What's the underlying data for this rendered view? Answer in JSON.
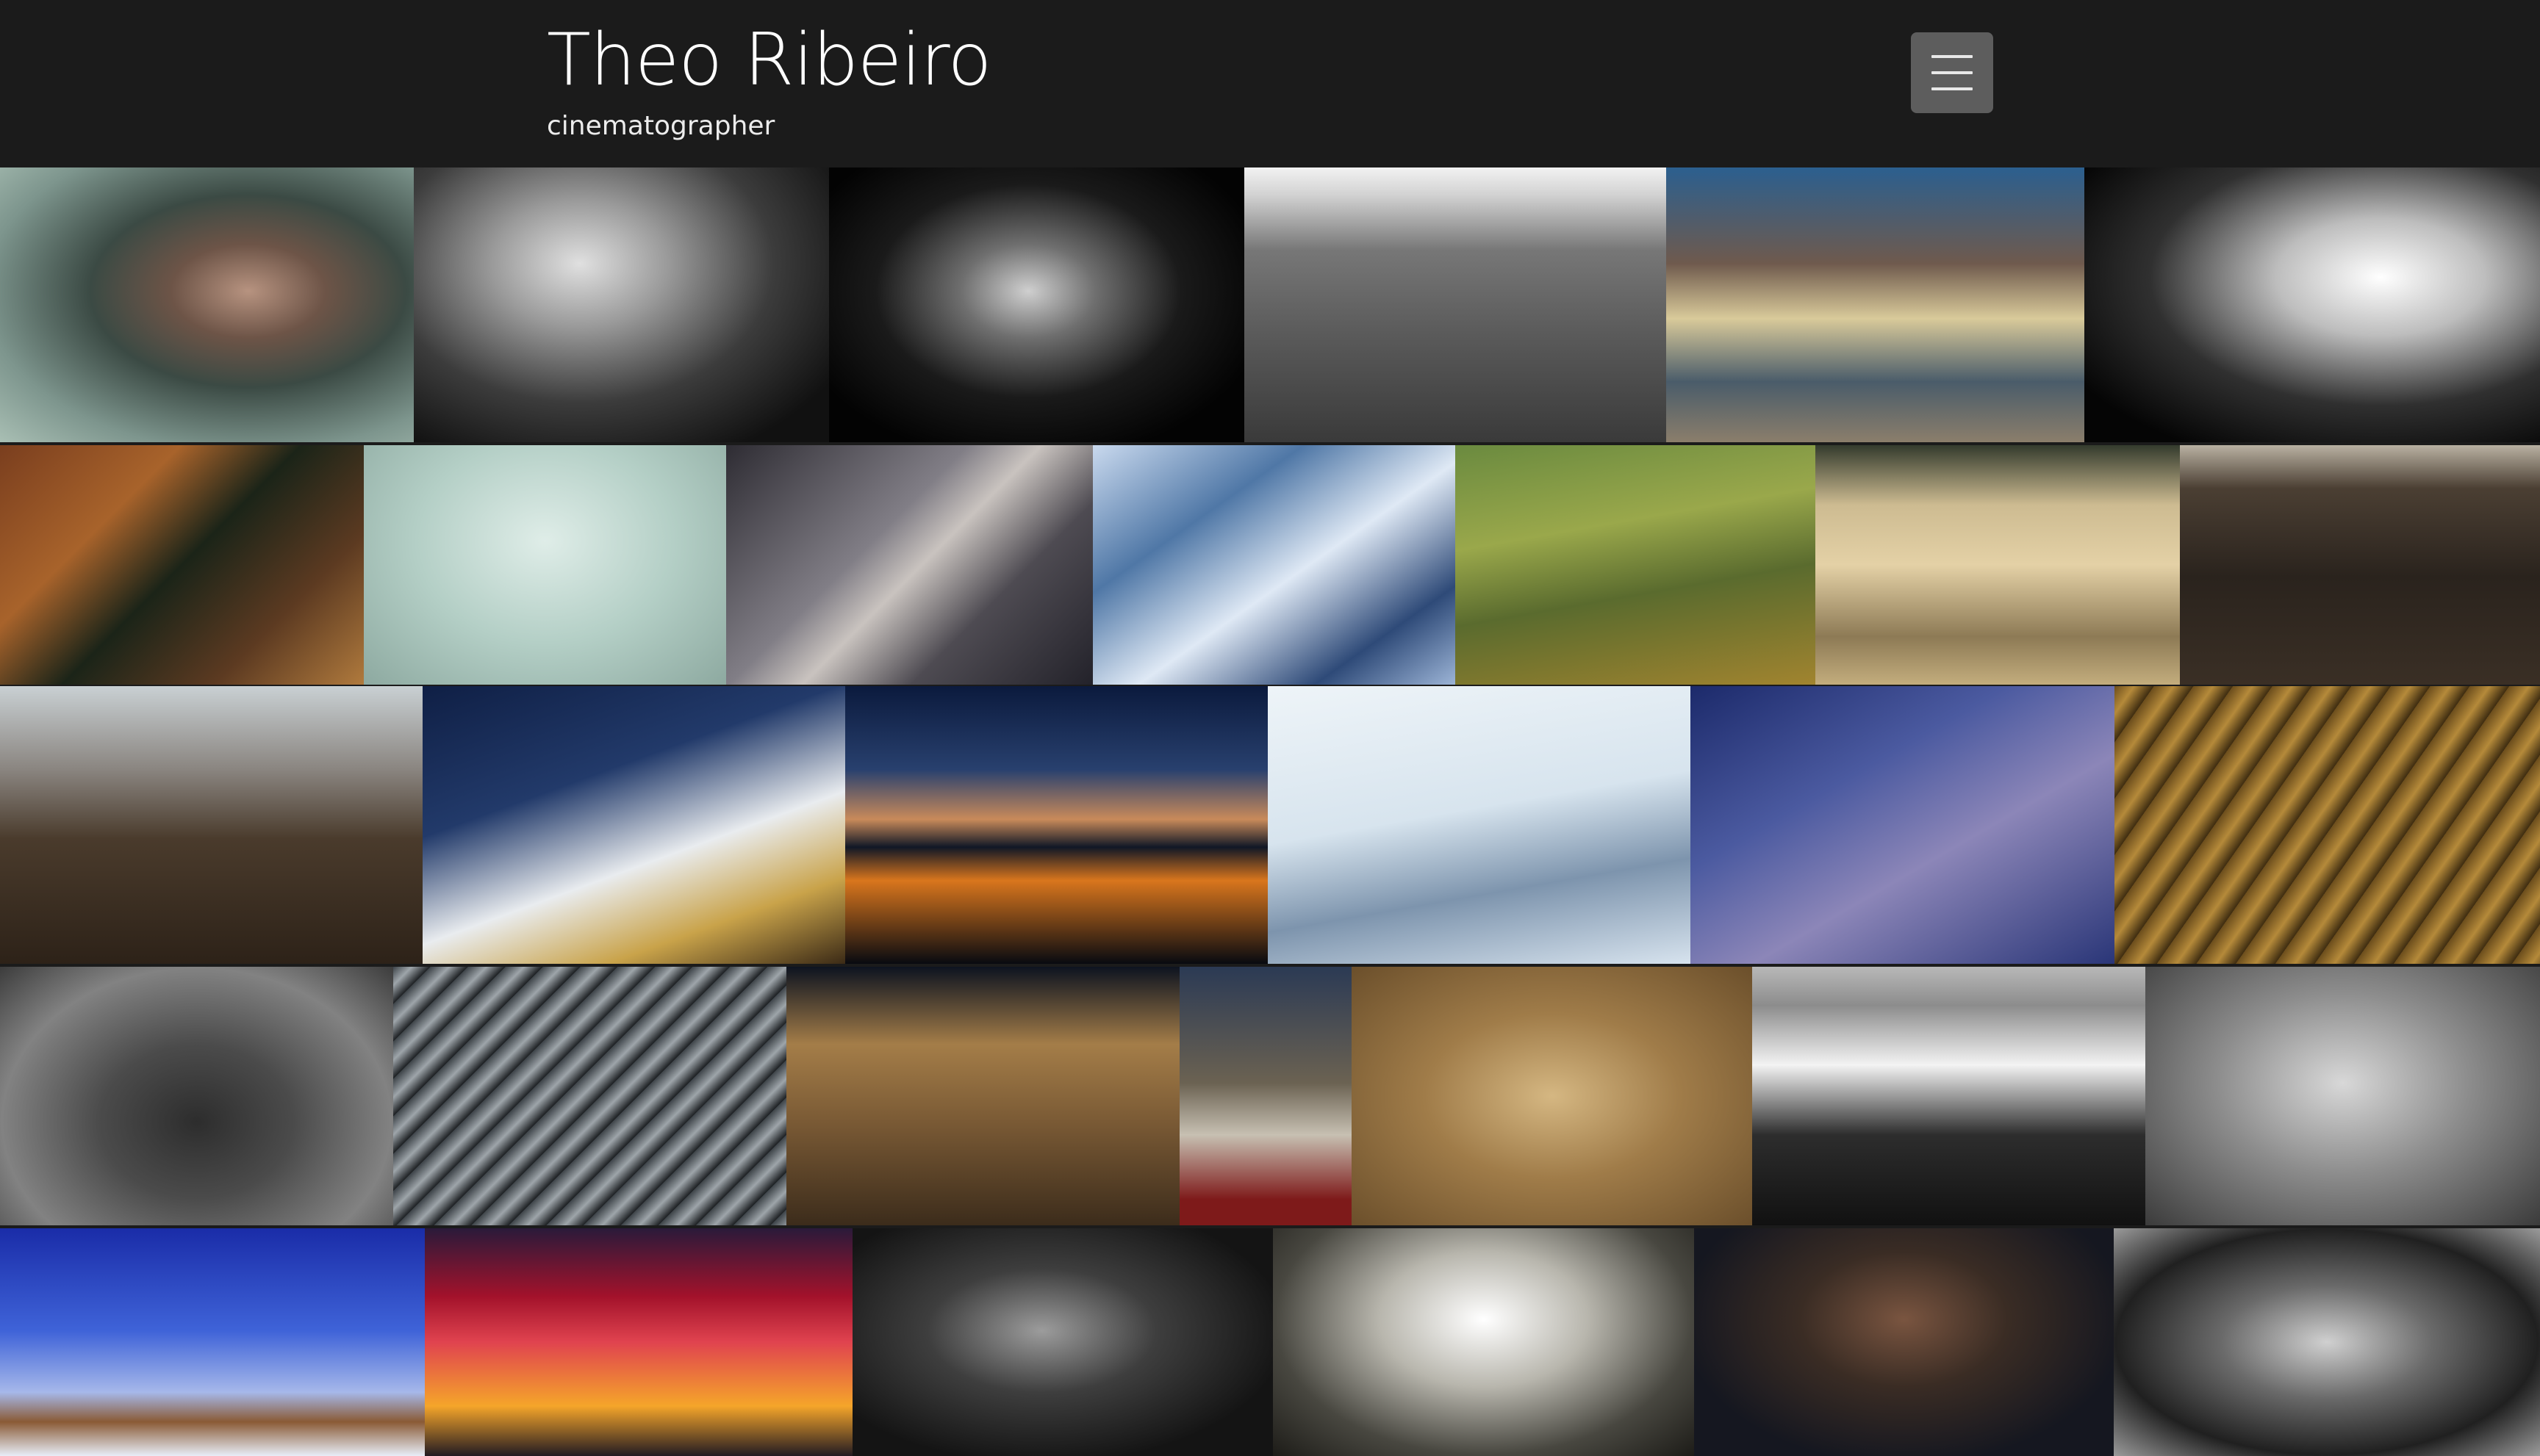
{
  "header": {
    "name": "Theo Ribeiro",
    "tagline": "cinematographer",
    "menu_icon": "hamburger-icon"
  },
  "gallery": {
    "rows": [
      {
        "tiles": [
          {
            "name": "photo-girl-portrait",
            "bg": "radial-gradient(ellipse at 60% 45%, #b79380 0%, #6d5447 22%, #3b4a44 45%, #7d958d 75%, #a9bfb4 100%)"
          },
          {
            "name": "photo-hands-over-eyes",
            "bg": "radial-gradient(ellipse at 40% 35%, #e0e0e0 0%, #9a9a9a 25%, #3c3c3c 55%, #111 85%)"
          },
          {
            "name": "photo-man-face-dark",
            "bg": "radial-gradient(ellipse at 48% 45%, #cfcfcf 0%, #6f6f6f 22%, #1a1a1a 50%, #030303 80%)"
          },
          {
            "name": "photo-building-bw",
            "bg": "linear-gradient(180deg, #f2f2f2 0%, #d2d2d2 10%, #777 30%, #5b5b5b 60%, #3a3a3a 100%)"
          },
          {
            "name": "photo-rickshaw-street",
            "bg": "linear-gradient(180deg, #2b5f8f 0%, #6f5a4d 35%, #d9ca9a 55%, #4a5c6a 78%, #8b7e6b 100%)"
          },
          {
            "name": "photo-car-drifting-smoke",
            "bg": "radial-gradient(ellipse at 65% 40%, #ffffff 0%, #bdbdbd 25%, #303030 55%, #050505 85%)"
          }
        ],
        "widths": [
          563,
          565,
          565,
          574,
          569,
          620
        ]
      },
      {
        "tiles": [
          {
            "name": "photo-climber-cliff",
            "bg": "linear-gradient(135deg, #7a3e1e 0%, #a8632b 30%, #1b2418 50%, #5c3a21 75%, #b07a3d 100%)"
          },
          {
            "name": "photo-mountaineers-fog",
            "bg": "radial-gradient(ellipse at 50% 40%, #dfede8 0%, #b4cfc6 50%, #8da9a0 100%)"
          },
          {
            "name": "photo-ice-axe-rock",
            "bg": "linear-gradient(135deg, #2e2c33 0%, #817e86 40%, #c9c3bf 52%, #4e4b52 70%, #23222a 100%)"
          },
          {
            "name": "photo-glacier-aerial",
            "bg": "linear-gradient(145deg, #c9d9ee 0%, #4f77a6 30%, #dfe9f5 55%, #2e4a78 80%, #9cb4d6 100%)"
          },
          {
            "name": "photo-green-field-road",
            "bg": "linear-gradient(170deg, #6a8a3f 0%, #9aa84b 35%, #5a6b2e 60%, #a1842f 100%)"
          },
          {
            "name": "photo-sand-dunes",
            "bg": "linear-gradient(180deg, #343b2d 0%, #cdbb91 25%, #e4d1a6 50%, #8d7a55 80%, #c3ad7d 100%)"
          },
          {
            "name": "photo-dark-hills-runner",
            "bg": "linear-gradient(180deg, #b9b1a2 0%, #4b3f33 18%, #2a231d 55%, #3a2f25 100%)"
          }
        ],
        "widths": [
          495,
          493,
          499,
          493,
          490,
          496,
          490
        ]
      },
      {
        "tiles": [
          {
            "name": "photo-cyclists-dust",
            "bg": "linear-gradient(180deg, #c9d0d3 0%, #8a8580 30%, #4a3b2c 55%, #2d2218 100%)"
          },
          {
            "name": "photo-mountaineer-snow-night",
            "bg": "linear-gradient(160deg, #0f1f45 0%, #223a6a 35%, #e9ecef 60%, #c9a34a 80%, #3b2a16 100%)"
          },
          {
            "name": "photo-tents-lake-dusk",
            "bg": "linear-gradient(180deg, #0b1a3d 0%, #28406e 30%, #c98a5a 48%, #101726 58%, #d9761d 70%, #080a10 100%)"
          },
          {
            "name": "photo-snowfield-climbers",
            "bg": "linear-gradient(170deg, #eef4f8 0%, #d7e4ee 45%, #7d94ad 70%, #d7e3ee 100%)"
          },
          {
            "name": "photo-terraced-valley",
            "bg": "linear-gradient(150deg, #1c2a6b 0%, #4b5aa0 35%, #8c86b8 60%, #2a3678 100%)"
          },
          {
            "name": "photo-crop-rows-golden",
            "bg": "repeating-linear-gradient(125deg, #6b4d1c 0px, #b58a3a 22px, #3e2c10 44px)"
          }
        ],
        "widths": [
          575,
          575,
          575,
          575,
          577,
          579
        ]
      },
      {
        "tiles": [
          {
            "name": "photo-forest-aerial-bw",
            "bg": "radial-gradient(ellipse at 50% 60%, #2d2d2d 0%, #4b4b4b 35%, #828282 70%, #3c3c3c 100%)"
          },
          {
            "name": "photo-batteries-rows",
            "bg": "repeating-linear-gradient(135deg, #3d4348 0px, #9ea5aa 18px, #1c1f22 36px)"
          },
          {
            "name": "photo-ruined-house-night",
            "bg": "linear-gradient(180deg, #0d1320 0%, #a47d48 30%, #7a5a35 60%, #3c2c1b 100%)"
          },
          {
            "name": "photo-man-sheep",
            "bg": "linear-gradient(180deg, #2b3a54 0%, #6b6252 45%, #c7c0b2 65%, #7e1a1a 90%)"
          },
          {
            "name": "photo-people-mud-helping",
            "bg": "radial-gradient(ellipse at 50% 50%, #d5b782 0%, #a07c49 45%, #6b4f2b 100%)"
          },
          {
            "name": "photo-boy-jumping-water",
            "bg": "linear-gradient(180deg, #b8b8b8 0%, #8c8c8c 15%, #f3f3f3 38%, #2d2d2d 65%, #111 100%)"
          },
          {
            "name": "photo-two-men-seated-bw",
            "bg": "radial-gradient(ellipse at 50% 45%, #d8d8d8 0%, #8d8d8d 45%, #3b3b3b 100%)"
          }
        ],
        "widths": [
          535,
          535,
          535,
          234,
          545,
          535,
          537
        ]
      },
      {
        "tiles": [
          {
            "name": "photo-cactus-salt-flat",
            "bg": "linear-gradient(180deg, #1a2ca8 0%, #3f63d8 45%, #a6b8ea 72%, #8a5a35 85%, #e8eef8 100%)"
          },
          {
            "name": "photo-sunset-city",
            "bg": "linear-gradient(180deg, #2a1a3a 0%, #a3122b 30%, #e0434f 50%, #f5a52a 78%, #221b22 100%)"
          },
          {
            "name": "photo-miner-helmet-bw",
            "bg": "radial-gradient(ellipse at 45% 45%, #9c9c9c 0%, #3e3e3e 35%, #141414 75%)"
          },
          {
            "name": "photo-boy-portrait-field",
            "bg": "radial-gradient(ellipse at 50% 40%, #ffffff 0%, #b8b6ad 35%, #484740 70%, #1d1c18 100%)"
          },
          {
            "name": "photo-woman-food",
            "bg": "radial-gradient(ellipse at 50% 40%, #7a5540 0%, #3a2c24 35%, #151720 75%)"
          },
          {
            "name": "photo-indigenous-man-bw",
            "bg": "radial-gradient(ellipse at 50% 50%, #d0d0d0 0%, #6a6a6a 35%, #202020 70%, #9b9b9b 100%)"
          }
        ],
        "widths": [
          578,
          582,
          572,
          573,
          571,
          580
        ]
      }
    ]
  }
}
